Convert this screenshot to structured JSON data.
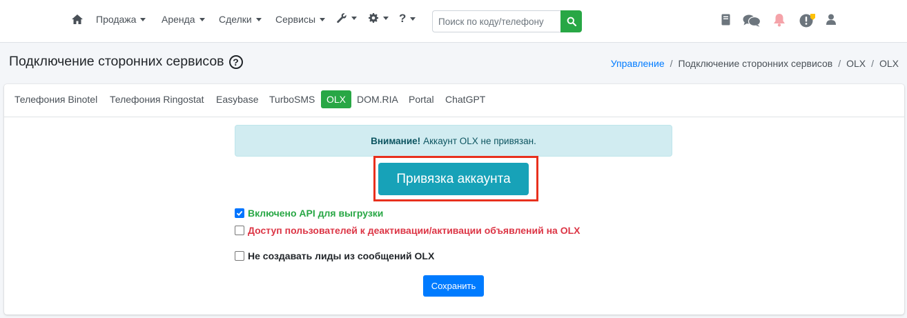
{
  "nav": {
    "home_icon": "home-icon",
    "items": [
      {
        "label": "Продажа"
      },
      {
        "label": "Аренда"
      },
      {
        "label": "Сделки"
      },
      {
        "label": "Сервисы"
      }
    ],
    "tools_icon": "wrench-icon",
    "settings_icon": "gear-icon",
    "help_label": "?",
    "search": {
      "placeholder": "Поиск по коду/телефону",
      "value": ""
    },
    "right_icons": [
      "book-icon",
      "chat-icon",
      "bell-icon",
      "alert-badge-icon",
      "user-icon"
    ]
  },
  "header": {
    "title": "Подключение сторонних сервисов",
    "help": "?",
    "breadcrumb": {
      "root": "Управление",
      "items": [
        "Подключение сторонних сервисов",
        "OLX",
        "OLX"
      ]
    }
  },
  "tabs": [
    {
      "label": "Телефония Binotel"
    },
    {
      "label": "Телефония Ringostat"
    },
    {
      "label": "Easybase"
    },
    {
      "label": "TurboSMS"
    },
    {
      "label": "OLX",
      "active": true
    },
    {
      "label": "DOM.RIA"
    },
    {
      "label": "Portal"
    },
    {
      "label": "ChatGPT"
    }
  ],
  "alert": {
    "strong": "Внимание!",
    "text": "Аккаунт OLX не привязан."
  },
  "link_button": "Привязка аккаунта",
  "options": [
    {
      "label": "Включено API для выгрузки",
      "checked": true
    },
    {
      "label": "Доступ пользователей к деактивации/активации объявлений на OLX",
      "checked": false
    },
    {
      "label": "Не создавать лиды из сообщений OLX",
      "checked": false
    }
  ],
  "save_button": "Сохранить",
  "colors": {
    "success": "#28a745",
    "danger": "#dc3545",
    "info": "#17a2b8",
    "primary": "#007bff",
    "highlight": "#e8301d"
  }
}
